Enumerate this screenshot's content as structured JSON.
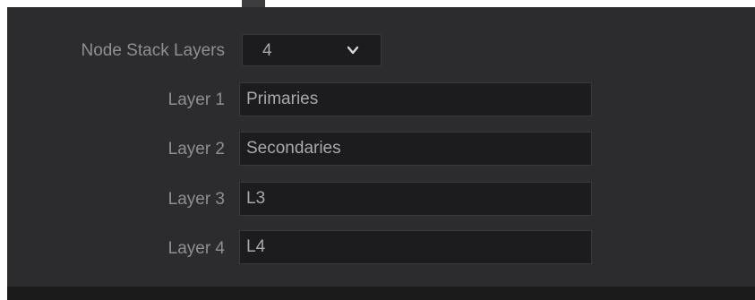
{
  "node_stack": {
    "label": "Node Stack Layers",
    "selected_value": "4",
    "dropdown_icon": "chevron-down-icon"
  },
  "layers": [
    {
      "label": "Layer 1",
      "value": "Primaries"
    },
    {
      "label": "Layer 2",
      "value": "Secondaries"
    },
    {
      "label": "Layer 3",
      "value": "L3"
    },
    {
      "label": "Layer 4",
      "value": "L4"
    }
  ],
  "colors": {
    "panel_background": "#2c2c2e",
    "field_background": "#1c1c1e",
    "label_text": "#8f8f93",
    "field_text": "#a9a9ad"
  }
}
